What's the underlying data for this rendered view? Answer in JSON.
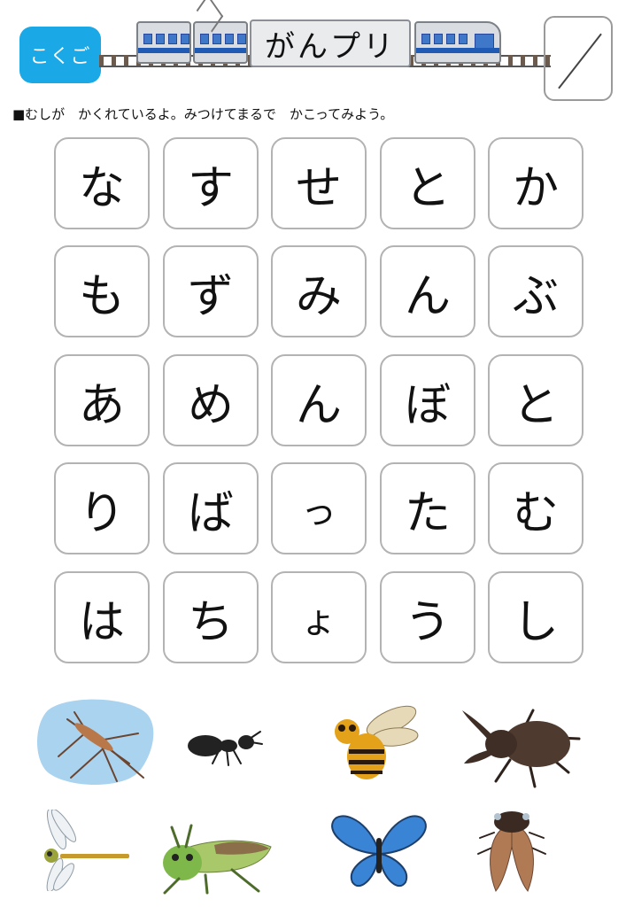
{
  "header": {
    "subject_label": "こくご",
    "title": "がんプリ"
  },
  "instruction": "■むしが　かくれているよ。みつけてまるで　かこってみよう。",
  "grid": {
    "rows": [
      [
        "な",
        "す",
        "せ",
        "と",
        "か"
      ],
      [
        "も",
        "ず",
        "み",
        "ん",
        "ぶ"
      ],
      [
        "あ",
        "め",
        "ん",
        "ぼ",
        "と"
      ],
      [
        "り",
        "ば",
        "っ",
        "た",
        "む"
      ],
      [
        "は",
        "ち",
        "ょ",
        "う",
        "し"
      ]
    ]
  },
  "insects": [
    {
      "icon": "water-strider-icon"
    },
    {
      "icon": "ant-icon"
    },
    {
      "icon": "hornet-icon"
    },
    {
      "icon": "rhinoceros-beetle-icon"
    },
    {
      "icon": "dragonfly-icon"
    },
    {
      "icon": "grasshopper-icon"
    },
    {
      "icon": "butterfly-icon"
    },
    {
      "icon": "cicada-icon"
    }
  ],
  "colors": {
    "badge": "#1aa8e6",
    "train_stripe": "#1f5bb5",
    "cell_border": "#b3b3b3"
  }
}
